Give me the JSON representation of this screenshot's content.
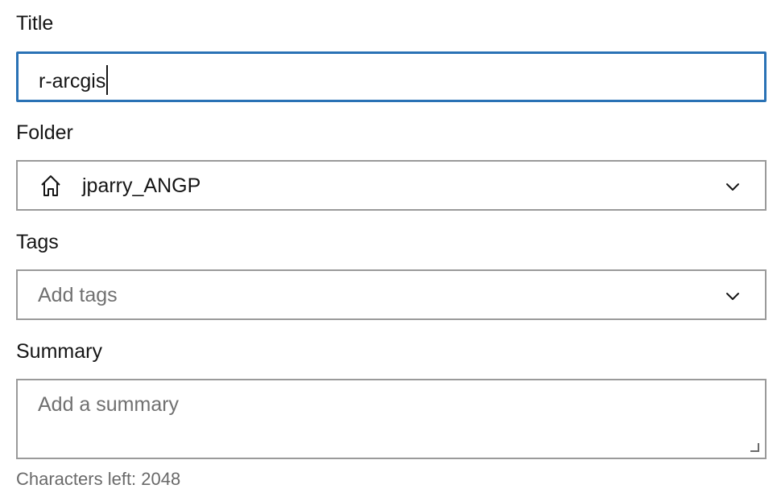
{
  "form": {
    "title": {
      "label": "Title",
      "value": "r-arcgis"
    },
    "folder": {
      "label": "Folder",
      "value": "jparry_ANGP",
      "icon": "home-icon"
    },
    "tags": {
      "label": "Tags",
      "placeholder": "Add tags"
    },
    "summary": {
      "label": "Summary",
      "placeholder": "Add a summary",
      "characters_left_text": "Characters left: 2048"
    }
  },
  "colors": {
    "focus_border": "#2a72b5",
    "input_border": "#9a9a9a",
    "placeholder": "#707070",
    "helper_text": "#6a6a6a"
  }
}
